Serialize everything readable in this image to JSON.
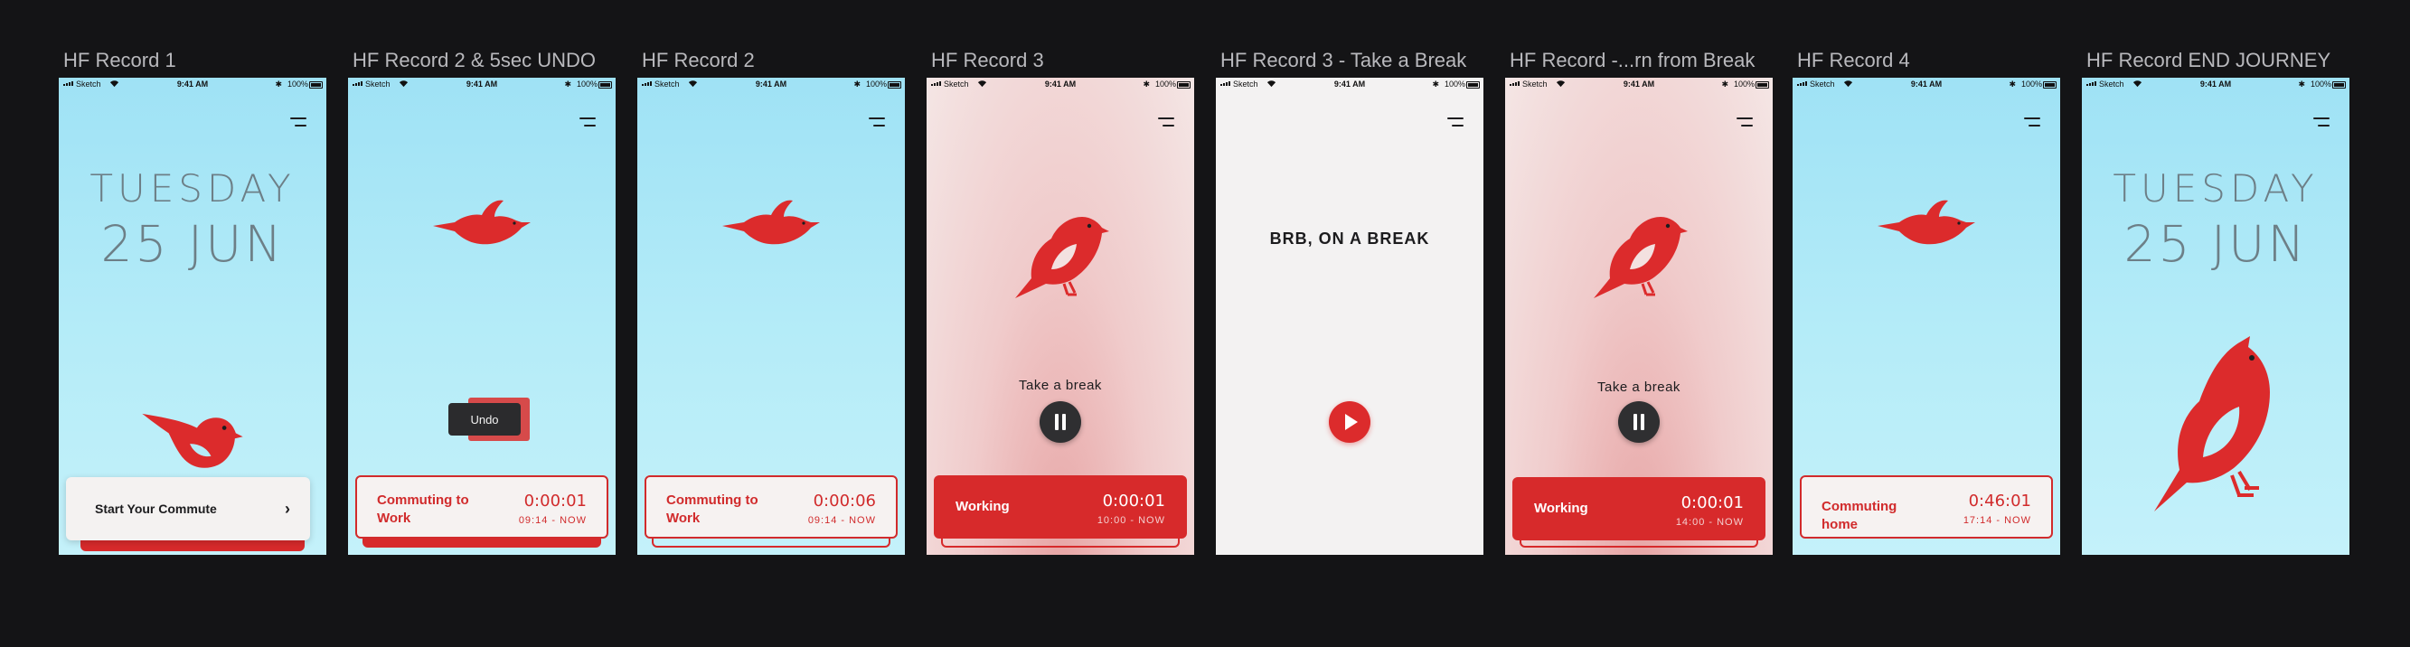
{
  "canvas": {
    "background": "#141416"
  },
  "colors": {
    "accent_red": "#d72a2b",
    "sky": "#b5ecf8",
    "blush": "#f0cbcb",
    "charcoal": "#2f2f31"
  },
  "status_bar": {
    "carrier": "Sketch",
    "time": "9:41 AM",
    "bluetooth": "✱",
    "battery": "100%"
  },
  "screens": [
    {
      "title": "HF Record 1",
      "day": "TUESDAY",
      "date": "25 JUN",
      "start_label": "Start Your Commute",
      "chevron": "›"
    },
    {
      "title": "HF Record 2 & 5sec UNDO",
      "undo_label": "Undo",
      "record": {
        "label": "Commuting to Work",
        "timer": "0:00:01",
        "range": "09:14 - NOW"
      }
    },
    {
      "title": "HF Record 2",
      "record": {
        "label": "Commuting to Work",
        "timer": "0:00:06",
        "range": "09:14 - NOW"
      }
    },
    {
      "title": "HF Record 3",
      "break_label": "Take a break",
      "record": {
        "label": "Working",
        "timer": "0:00:01",
        "range": "10:00 - NOW"
      }
    },
    {
      "title": "HF Record 3 - Take a Break",
      "brb": "BRB, ON A BREAK"
    },
    {
      "title": "HF Record -...rn from Break",
      "break_label": "Take a break",
      "record": {
        "label": "Working",
        "timer": "0:00:01",
        "range": "14:00 - NOW"
      }
    },
    {
      "title": "HF Record 4",
      "record": {
        "label": "Commuting home",
        "timer": "0:46:01",
        "range": "17:14 - NOW"
      }
    },
    {
      "title": "HF Record END JOURNEY",
      "day": "TUESDAY",
      "date": "25 JUN"
    }
  ]
}
